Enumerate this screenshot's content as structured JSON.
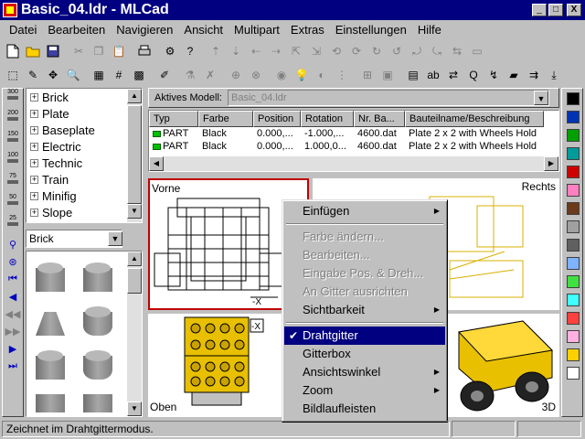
{
  "window": {
    "title": "Basic_04.ldr - MLCad",
    "min_label": "_",
    "max_label": "□",
    "close_label": "X"
  },
  "menu": [
    "Datei",
    "Bearbeiten",
    "Navigieren",
    "Ansicht",
    "Multipart",
    "Extras",
    "Einstellungen",
    "Hilfe"
  ],
  "zoom_levels": [
    "300",
    "200",
    "150",
    "100",
    "75",
    "50",
    "25"
  ],
  "tree": {
    "items": [
      "Brick",
      "Plate",
      "Baseplate",
      "Electric",
      "Technic",
      "Train",
      "Minifig",
      "Slope"
    ]
  },
  "category_combo": {
    "value": "Brick"
  },
  "model_bar": {
    "label": "Aktives Modell:",
    "value": "Basic_04.ldr"
  },
  "part_list": {
    "columns": [
      "Typ",
      "Farbe",
      "Position",
      "Rotation",
      "Nr. Ba...",
      "Bauteilname/Beschreibung"
    ],
    "rows": [
      [
        "PART",
        "Black",
        "0.000,...",
        "-1.000,...",
        "4600.dat",
        "Plate  2 x  2 with Wheels Hold"
      ],
      [
        "PART",
        "Black",
        "0.000,...",
        "1.000,0...",
        "4600.dat",
        "Plate  2 x  2 with Wheels Hold"
      ]
    ]
  },
  "viewports": {
    "front": "Vorne",
    "right": "Rechts",
    "top": "Oben",
    "perspective": "3D"
  },
  "context_menu": {
    "items": [
      {
        "label": "Einfügen",
        "state": "normal",
        "submenu": true
      },
      {
        "label": "Farbe ändern...",
        "state": "disabled",
        "submenu": false
      },
      {
        "label": "Bearbeiten...",
        "state": "disabled",
        "submenu": false
      },
      {
        "label": "Eingabe Pos. & Dreh...",
        "state": "disabled",
        "submenu": false
      },
      {
        "label": "An Gitter ausrichten",
        "state": "disabled",
        "submenu": false
      },
      {
        "label": "Sichtbarkeit",
        "state": "normal",
        "submenu": true
      },
      {
        "label": "Drahtgitter",
        "state": "highlighted",
        "submenu": false,
        "checked": true
      },
      {
        "label": "Gitterbox",
        "state": "normal",
        "submenu": false
      },
      {
        "label": "Ansichtswinkel",
        "state": "normal",
        "submenu": true
      },
      {
        "label": "Zoom",
        "state": "normal",
        "submenu": true
      },
      {
        "label": "Bildlaufleisten",
        "state": "normal",
        "submenu": false
      }
    ]
  },
  "palette": [
    "#000000",
    "#0033b2",
    "#00a000",
    "#009a9a",
    "#d00000",
    "#ff80c0",
    "#6b3a1a",
    "#a0a0a0",
    "#606060",
    "#7fb2ff",
    "#40e040",
    "#40ffff",
    "#ff4040",
    "#ffb0e0",
    "#ffd000",
    "#ffffff"
  ],
  "status": {
    "text": "Zeichnet im Drahtgittermodus."
  },
  "colors": {
    "title_bar": "#000080",
    "highlight": "#000080",
    "active_view_border": "#c00000",
    "brick_yellow": "#e8c000"
  }
}
